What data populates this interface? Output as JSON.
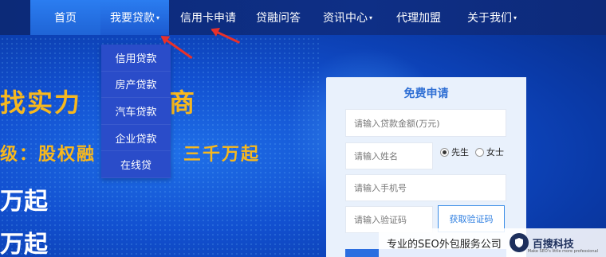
{
  "nav": {
    "items": [
      {
        "label": "首页"
      },
      {
        "label": "我要贷款"
      },
      {
        "label": "信用卡申请"
      },
      {
        "label": "贷融问答"
      },
      {
        "label": "资讯中心"
      },
      {
        "label": "代理加盟"
      },
      {
        "label": "关于我们"
      }
    ],
    "caret": "▾"
  },
  "dropdown": {
    "items": [
      "信用贷款",
      "房产贷款",
      "汽车贷款",
      "企业贷款",
      "在线贷"
    ]
  },
  "hero": {
    "line1a": "找实力",
    "line1b": "商",
    "line2a": "级：股权融",
    "line2b": "三千万起",
    "line3": "万起",
    "line4": "万起"
  },
  "form": {
    "title": "免费申请",
    "amount_placeholder": "请输入贷款金额(万元)",
    "name_placeholder": "请输入姓名",
    "gender": {
      "male": "先生",
      "female": "女士",
      "selected": "先生"
    },
    "phone_placeholder": "请输入手机号",
    "code_placeholder": "请输入验证码",
    "code_button": "获取验证码"
  },
  "watermark": {
    "text": "专业的SEO外包服务公司",
    "brand": "百搜科技",
    "sub": "Make SEO's little more professional"
  },
  "colors": {
    "nav_active": "#2b7df0",
    "headline": "#f7b81e",
    "arrow": "#e8312a",
    "form_title": "#2f6fd4"
  }
}
